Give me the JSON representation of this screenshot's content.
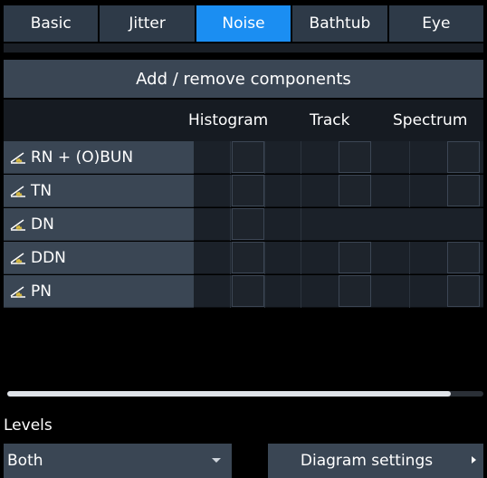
{
  "tabs": [
    {
      "label": "Basic",
      "active": false
    },
    {
      "label": "Jitter",
      "active": false
    },
    {
      "label": "Noise",
      "active": true
    },
    {
      "label": "Bathtub",
      "active": false
    },
    {
      "label": "Eye",
      "active": false
    }
  ],
  "add_remove_label": "Add / remove components",
  "columns": {
    "histogram": "Histogram",
    "track": "Track",
    "spectrum": "Spectrum"
  },
  "rows": [
    {
      "label": "RN + (O)BUN",
      "icon": "noise-waveform-icon",
      "histogram": true,
      "track": true,
      "spectrum": true
    },
    {
      "label": "TN",
      "icon": "noise-waveform-icon",
      "histogram": true,
      "track": true,
      "spectrum": true
    },
    {
      "label": "DN",
      "icon": "noise-waveform-icon",
      "histogram": true,
      "track": false,
      "spectrum": false
    },
    {
      "label": "DDN",
      "icon": "noise-waveform-icon",
      "histogram": true,
      "track": true,
      "spectrum": true
    },
    {
      "label": "PN",
      "icon": "noise-waveform-icon",
      "histogram": true,
      "track": true,
      "spectrum": true
    }
  ],
  "levels": {
    "label": "Levels",
    "selected": "Both"
  },
  "diagram_settings_label": "Diagram settings",
  "colors": {
    "accent": "#1b8ef2",
    "panel": "#3a4654",
    "icon_yellow": "#e0c040"
  }
}
